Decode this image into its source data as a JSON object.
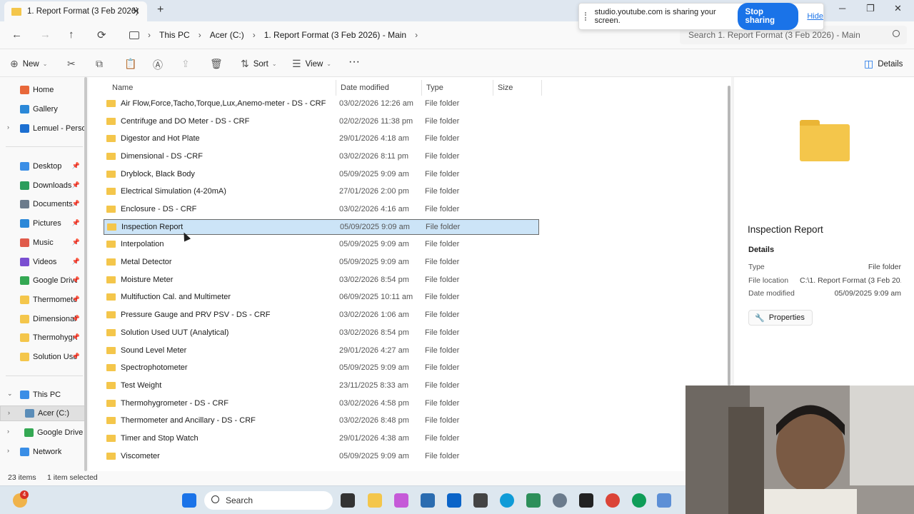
{
  "tab": {
    "title": "1. Report Format (3 Feb 2026)",
    "close": "✕",
    "new": "+"
  },
  "window": {
    "minimize": "─",
    "restore": "❐",
    "close": "✕"
  },
  "nav": {
    "back": "←",
    "forward": "→",
    "up": "↑",
    "refresh": "⟳"
  },
  "breadcrumb": [
    "This PC",
    "Acer (C:)",
    "1. Report Format (3 Feb 2026) - Main"
  ],
  "breadcrumb_sep": "›",
  "search": {
    "placeholder": "Search 1. Report Format (3 Feb 2026) - Main"
  },
  "share_notice": {
    "text": "studio.youtube.com is sharing your screen.",
    "stop": "Stop sharing",
    "hide": "Hide"
  },
  "toolbar": {
    "new": "New",
    "sort": "Sort",
    "view": "View",
    "more": "···",
    "details": "Details",
    "icons": {
      "new": "⊕",
      "cut": "✂",
      "copy": "⧉",
      "paste": "📋",
      "rename": "Ⓐ",
      "share": "⇪",
      "delete": "🗑",
      "sort": "⇅",
      "view": "☰",
      "details": "◫"
    },
    "chev": "⌄"
  },
  "sidebar": {
    "top": [
      {
        "label": "Home",
        "icon": "home-icon",
        "color": "#e8683a"
      },
      {
        "label": "Gallery",
        "icon": "gallery-icon",
        "color": "#2b88d8"
      },
      {
        "label": "Lemuel - Person",
        "icon": "onedrive-icon",
        "color": "#1c6fd1"
      }
    ],
    "pinned": [
      {
        "label": "Desktop",
        "icon": "desktop-icon",
        "color": "#3a8ee6"
      },
      {
        "label": "Downloads",
        "icon": "download-icon",
        "color": "#2a9d5c"
      },
      {
        "label": "Documents",
        "icon": "documents-icon",
        "color": "#6b7b8c"
      },
      {
        "label": "Pictures",
        "icon": "pictures-icon",
        "color": "#2b88d8"
      },
      {
        "label": "Music",
        "icon": "music-icon",
        "color": "#e05a4a"
      },
      {
        "label": "Videos",
        "icon": "videos-icon",
        "color": "#7a4fd1"
      },
      {
        "label": "Google Drive",
        "icon": "google-drive-icon",
        "color": "#34a853"
      },
      {
        "label": "Thermomete",
        "icon": "folder-icon",
        "color": "#f4c64b"
      },
      {
        "label": "Dimensional",
        "icon": "folder-icon",
        "color": "#f4c64b"
      },
      {
        "label": "Thermohygrc",
        "icon": "folder-icon",
        "color": "#f4c64b"
      },
      {
        "label": "Solution Usec",
        "icon": "folder-icon",
        "color": "#f4c64b"
      }
    ],
    "bottom": [
      {
        "label": "This PC",
        "icon": "pc-icon",
        "color": "#3a8ee6"
      },
      {
        "label": "Acer (C:)",
        "icon": "drive-icon",
        "color": "#5b8db8"
      },
      {
        "label": "Google Drive (",
        "icon": "google-drive-icon",
        "color": "#34a853"
      },
      {
        "label": "Network",
        "icon": "network-icon",
        "color": "#3a8ee6"
      }
    ],
    "pin": "📌",
    "expand": "›",
    "expanded": "⌄"
  },
  "columns": {
    "name": "Name",
    "date": "Date modified",
    "type": "Type",
    "size": "Size"
  },
  "files": [
    {
      "name": "Air Flow,Force,Tacho,Torque,Lux,Anemo-meter - DS - CRF",
      "date": "03/02/2026 12:26 am",
      "type": "File folder"
    },
    {
      "name": "Centrifuge and DO Meter - DS - CRF",
      "date": "02/02/2026 11:38 pm",
      "type": "File folder"
    },
    {
      "name": "Digestor and Hot Plate",
      "date": "29/01/2026 4:18 am",
      "type": "File folder"
    },
    {
      "name": "Dimensional - DS -CRF",
      "date": "03/02/2026 8:11 pm",
      "type": "File folder"
    },
    {
      "name": "Dryblock, Black Body",
      "date": "05/09/2025 9:09 am",
      "type": "File folder"
    },
    {
      "name": "Electrical Simulation (4-20mA)",
      "date": "27/01/2026 2:00 pm",
      "type": "File folder"
    },
    {
      "name": "Enclosure - DS - CRF",
      "date": "03/02/2026 4:16 am",
      "type": "File folder"
    },
    {
      "name": "Inspection Report",
      "date": "05/09/2025 9:09 am",
      "type": "File folder",
      "selected": true
    },
    {
      "name": "Interpolation",
      "date": "05/09/2025 9:09 am",
      "type": "File folder"
    },
    {
      "name": "Metal Detector",
      "date": "05/09/2025 9:09 am",
      "type": "File folder"
    },
    {
      "name": "Moisture Meter",
      "date": "03/02/2026 8:54 pm",
      "type": "File folder"
    },
    {
      "name": "Multifuction Cal. and Multimeter",
      "date": "06/09/2025 10:11 am",
      "type": "File folder"
    },
    {
      "name": "Pressure Gauge and PRV PSV - DS - CRF",
      "date": "03/02/2026 1:06 am",
      "type": "File folder"
    },
    {
      "name": "Solution Used UUT (Analytical)",
      "date": "03/02/2026 8:54 pm",
      "type": "File folder"
    },
    {
      "name": "Sound Level Meter",
      "date": "29/01/2026 4:27 am",
      "type": "File folder"
    },
    {
      "name": "Spectrophotometer",
      "date": "05/09/2025 9:09 am",
      "type": "File folder"
    },
    {
      "name": "Test Weight",
      "date": "23/11/2025 8:33 am",
      "type": "File folder"
    },
    {
      "name": "Thermohygrometer - DS - CRF",
      "date": "03/02/2026 4:58 pm",
      "type": "File folder"
    },
    {
      "name": "Thermometer and Ancillary - DS - CRF",
      "date": "03/02/2026 8:48 pm",
      "type": "File folder"
    },
    {
      "name": "Timer and Stop Watch",
      "date": "29/01/2026 4:38 am",
      "type": "File folder"
    },
    {
      "name": "Viscometer",
      "date": "05/09/2025 9:09 am",
      "type": "File folder"
    }
  ],
  "details": {
    "title": "Inspection Report",
    "section": "Details",
    "type_label": "Type",
    "type_value": "File folder",
    "location_label": "File location",
    "location_value": "C:\\1. Report Format (3 Feb 20...",
    "date_label": "Date modified",
    "date_value": "05/09/2025 9:09 am",
    "properties": "Properties",
    "properties_icon": "🔧"
  },
  "status": {
    "items": "23 items",
    "selected": "1 item selected"
  },
  "taskbar": {
    "search": "Search",
    "badge": "4"
  }
}
